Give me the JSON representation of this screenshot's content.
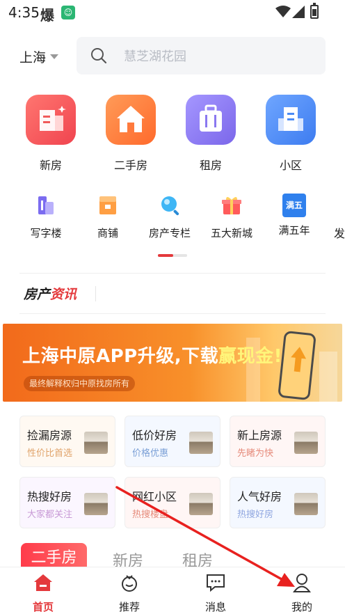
{
  "status_bar": {
    "time": "4:35",
    "icon1": "爆",
    "icon2": "☺"
  },
  "search": {
    "city": "上海",
    "placeholder": "慧芝湖花园"
  },
  "big_nav": [
    {
      "label": "新房",
      "icon": "new-house-icon",
      "color": "#f5505a"
    },
    {
      "label": "二手房",
      "icon": "house-icon",
      "color": "#ff7a3d"
    },
    {
      "label": "租房",
      "icon": "suitcase-icon",
      "color": "#8a78f0"
    },
    {
      "label": "小区",
      "icon": "building-icon",
      "color": "#4b8bf5"
    }
  ],
  "small_nav": [
    {
      "label": "写字楼",
      "icon": "office-icon"
    },
    {
      "label": "商铺",
      "icon": "shop-icon"
    },
    {
      "label": "房产专栏",
      "icon": "column-icon"
    },
    {
      "label": "五大新城",
      "icon": "gift-icon"
    },
    {
      "label": "满五年",
      "icon": "calendar-icon",
      "badge": "满五"
    },
    {
      "label": "发",
      "icon": "more-icon"
    }
  ],
  "news": {
    "title_part1": "房产",
    "title_part2": "资讯"
  },
  "banner": {
    "title_a": "上海中原APP升级,下载",
    "title_b": "赢现金!",
    "subtitle": "最终解释权归中原找房所有"
  },
  "cards": [
    {
      "title": "捡漏房源",
      "subtitle": "性价比首选",
      "sub_color": "#e0a36a"
    },
    {
      "title": "低价好房",
      "subtitle": "价格优惠",
      "sub_color": "#7a9fd6"
    },
    {
      "title": "新上房源",
      "subtitle": "先睹为快",
      "sub_color": "#e68a7a"
    },
    {
      "title": "热搜好房",
      "subtitle": "大家都关注",
      "sub_color": "#c89ad6"
    },
    {
      "title": "网红小区",
      "subtitle": "热搜楼盘",
      "sub_color": "#e68a7a"
    },
    {
      "title": "人气好房",
      "subtitle": "热搜好房",
      "sub_color": "#8fa6e0"
    }
  ],
  "list_tabs": {
    "active": "二手房",
    "tab2": "新房",
    "tab3": "租房"
  },
  "bottom_nav": [
    {
      "label": "首页",
      "icon": "home-icon",
      "active": true
    },
    {
      "label": "推荐",
      "icon": "recommend-icon",
      "active": false
    },
    {
      "label": "消息",
      "icon": "message-icon",
      "active": false
    },
    {
      "label": "我的",
      "icon": "profile-icon",
      "active": false
    }
  ],
  "colors": {
    "accent": "#e4393c"
  }
}
